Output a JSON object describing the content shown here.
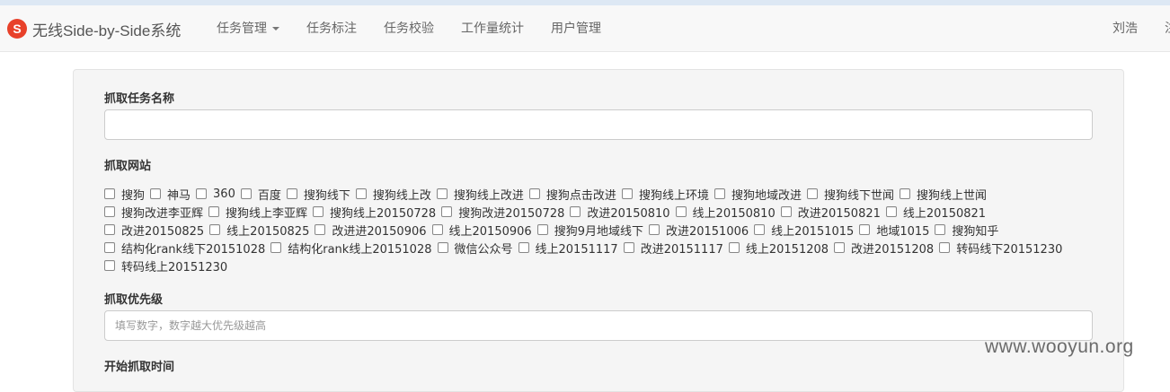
{
  "brand": {
    "logo_glyph": "S",
    "title": "无线Side-by-Side系统",
    "logo_color": "#e8412a"
  },
  "nav": {
    "items": [
      {
        "label": "任务管理",
        "dropdown": true
      },
      {
        "label": "任务标注"
      },
      {
        "label": "任务校验"
      },
      {
        "label": "工作量统计"
      },
      {
        "label": "用户管理"
      }
    ],
    "user_name": "刘浩",
    "user_extra": "注"
  },
  "form": {
    "task_name": {
      "label": "抓取任务名称",
      "value": "",
      "placeholder": ""
    },
    "sites": {
      "label": "抓取网站",
      "rows": [
        [
          "搜狗",
          "神马",
          "360",
          "百度",
          "搜狗线下",
          "搜狗线上改",
          "搜狗线上改进",
          "搜狗点击改进",
          "搜狗线上环境",
          "搜狗地域改进",
          "搜狗线下世闻",
          "搜狗线上世闻"
        ],
        [
          "搜狗改进李亚辉",
          "搜狗线上李亚辉",
          "搜狗线上20150728",
          "搜狗改进20150728",
          "改进20150810",
          "线上20150810",
          "改进20150821",
          "线上20150821"
        ],
        [
          "改进20150825",
          "线上20150825",
          "改进进20150906",
          "线上20150906",
          "搜狗9月地域线下",
          "改进20151006",
          "线上20151015",
          "地域1015",
          "搜狗知乎"
        ],
        [
          "结构化rank线下20151028",
          "结构化rank线上20151028",
          "微信公众号",
          "线上20151117",
          "改进20151117",
          "线上20151208",
          "改进20151208",
          "转码线下20151230"
        ],
        [
          "转码线上20151230"
        ]
      ]
    },
    "priority": {
      "label": "抓取优先级",
      "value": "",
      "placeholder": "填写数字，数字越大优先级越高"
    },
    "start_time": {
      "label": "开始抓取时间"
    }
  },
  "watermark": "www.wooyun.org"
}
